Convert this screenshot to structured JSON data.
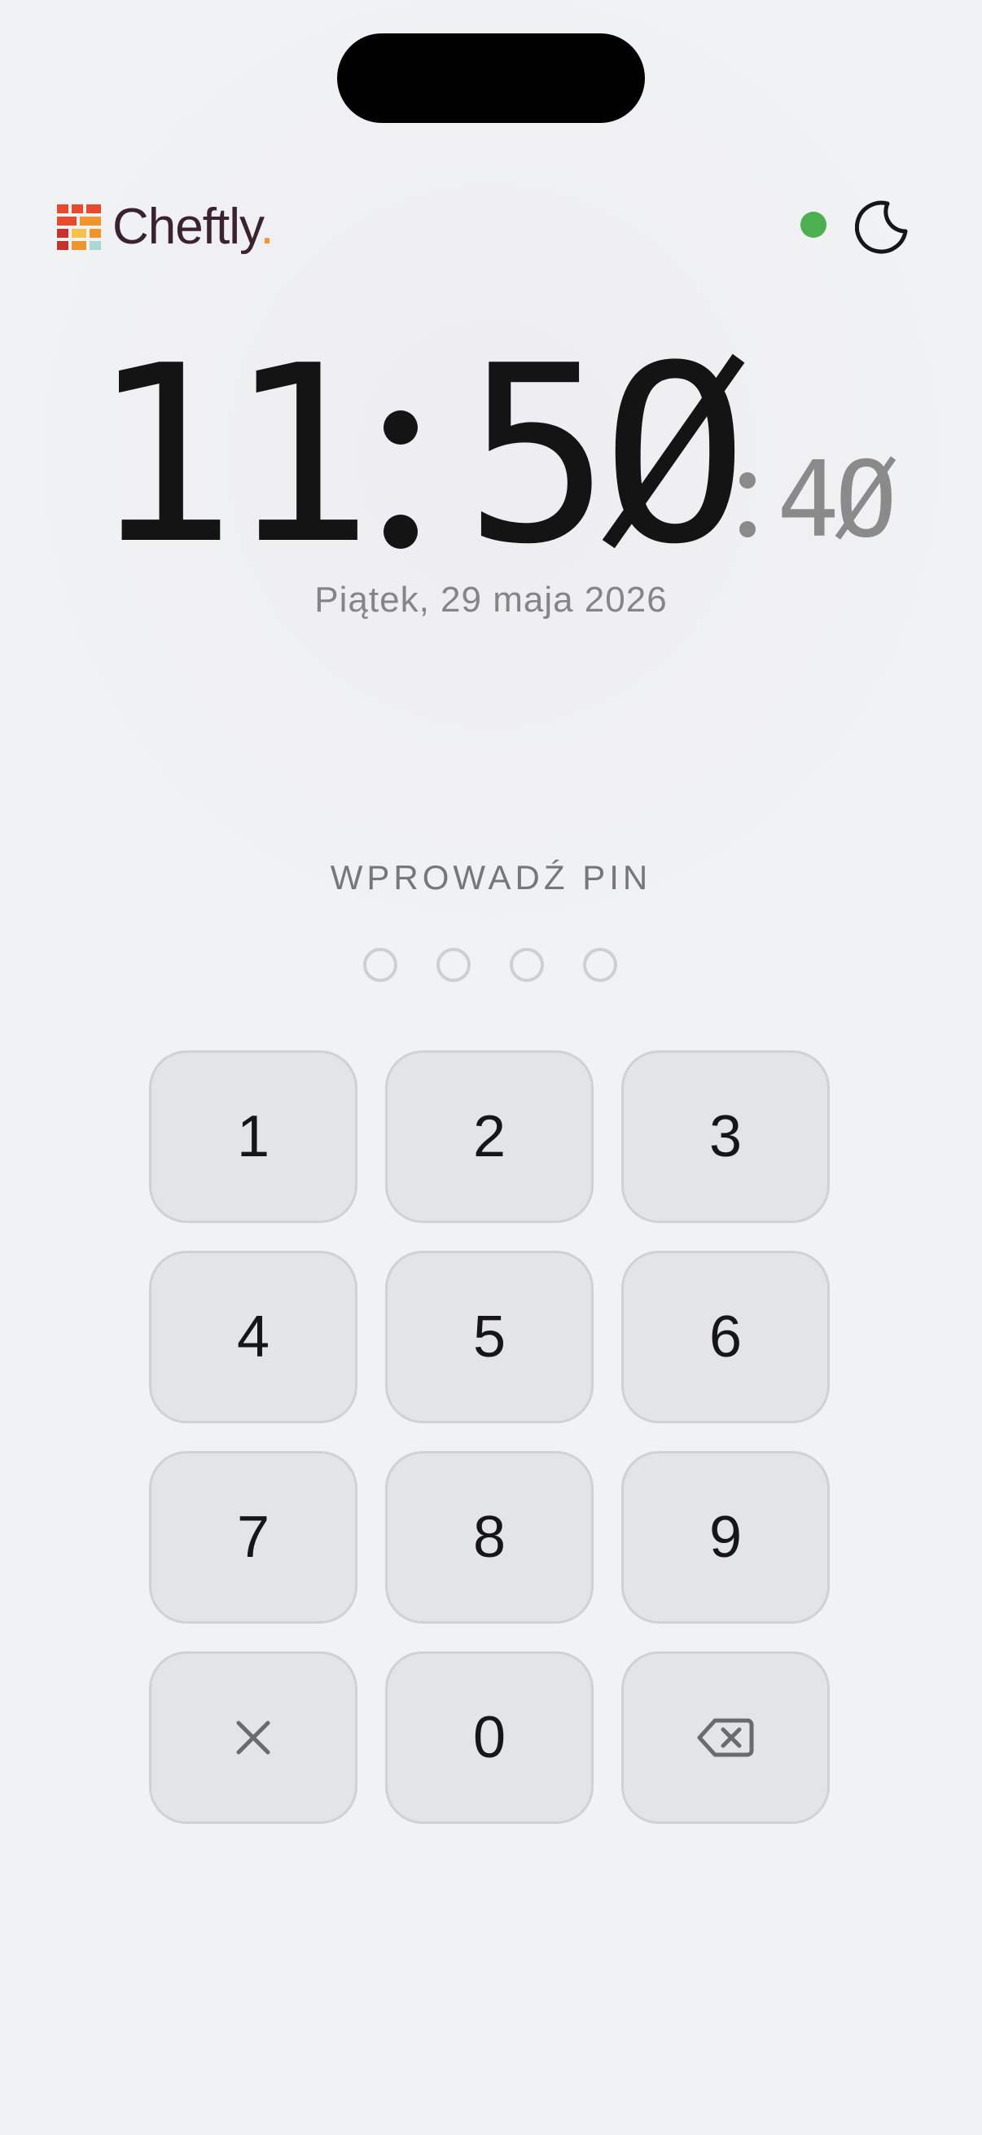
{
  "app": {
    "brand_name": "Cheftly",
    "brand_dot": ".",
    "logo_colors": [
      "#e84a2e",
      "#f0952a",
      "#f6c24a",
      "#a8d8d0",
      "#c9322a"
    ],
    "status_color": "#4caf50",
    "status_icon": "online-status-dot",
    "theme_icon": "moon-icon"
  },
  "clock": {
    "hours": "11",
    "minutes": "5Ø",
    "seconds": "4Ø",
    "date": "Piątek, 29 maja 2026"
  },
  "pin": {
    "label": "WPROWADŹ PIN",
    "length": 4,
    "entered": 0
  },
  "keypad": {
    "keys": [
      {
        "label": "1",
        "type": "digit"
      },
      {
        "label": "2",
        "type": "digit"
      },
      {
        "label": "3",
        "type": "digit"
      },
      {
        "label": "4",
        "type": "digit"
      },
      {
        "label": "5",
        "type": "digit"
      },
      {
        "label": "6",
        "type": "digit"
      },
      {
        "label": "7",
        "type": "digit"
      },
      {
        "label": "8",
        "type": "digit"
      },
      {
        "label": "9",
        "type": "digit"
      },
      {
        "label": "",
        "type": "clear",
        "icon": "close-icon"
      },
      {
        "label": "0",
        "type": "digit"
      },
      {
        "label": "",
        "type": "backspace",
        "icon": "backspace-icon"
      }
    ]
  }
}
